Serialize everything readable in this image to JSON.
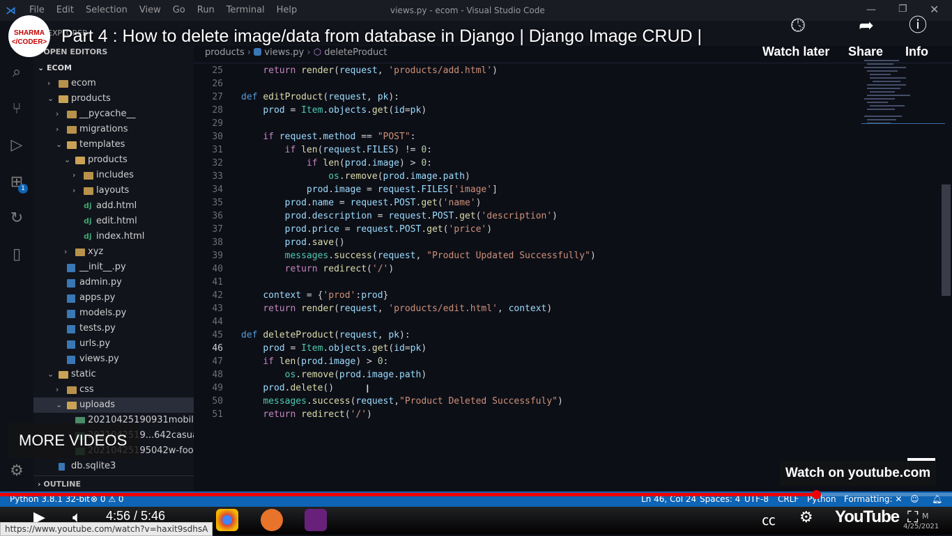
{
  "window": {
    "title": "views.py - ecom - Visual Studio Code",
    "menu": [
      "File",
      "Edit",
      "Selection",
      "View",
      "Go",
      "Run",
      "Terminal",
      "Help"
    ]
  },
  "youtube": {
    "title": "Part 4 : How to delete image/data from database in Django | Django Image CRUD |",
    "channel_line1": "SHARMA",
    "channel_line2": "</CODER>",
    "watch_later": "Watch later",
    "share": "Share",
    "info": "Info",
    "more_videos": "MORE VIDEOS",
    "watch_on": "Watch on youtube.com",
    "time": "4:56 / 5:46",
    "progress": 0.857,
    "url_tooltip": "https://www.youtube.com/watch?v=haxit9sdhsA",
    "logo_text": "YouTube"
  },
  "sidebar": {
    "explorer": "EXPLORER",
    "open_editors": "OPEN EDITORS",
    "root": "ECOM",
    "tree": [
      {
        "label": "ecom",
        "depth": 1,
        "kind": "folder",
        "open": false
      },
      {
        "label": "products",
        "depth": 1,
        "kind": "folder",
        "open": true
      },
      {
        "label": "__pycache__",
        "depth": 2,
        "kind": "folder",
        "open": false
      },
      {
        "label": "migrations",
        "depth": 2,
        "kind": "folder",
        "open": false
      },
      {
        "label": "templates",
        "depth": 2,
        "kind": "folder",
        "open": true
      },
      {
        "label": "products",
        "depth": 3,
        "kind": "folder",
        "open": true
      },
      {
        "label": "includes",
        "depth": 4,
        "kind": "folder",
        "open": false
      },
      {
        "label": "layouts",
        "depth": 4,
        "kind": "folder",
        "open": false
      },
      {
        "label": "add.html",
        "depth": 4,
        "kind": "dj"
      },
      {
        "label": "edit.html",
        "depth": 4,
        "kind": "dj"
      },
      {
        "label": "index.html",
        "depth": 4,
        "kind": "dj"
      },
      {
        "label": "xyz",
        "depth": 3,
        "kind": "folder",
        "open": false
      },
      {
        "label": "__init__.py",
        "depth": 2,
        "kind": "py"
      },
      {
        "label": "admin.py",
        "depth": 2,
        "kind": "py"
      },
      {
        "label": "apps.py",
        "depth": 2,
        "kind": "py"
      },
      {
        "label": "models.py",
        "depth": 2,
        "kind": "py"
      },
      {
        "label": "tests.py",
        "depth": 2,
        "kind": "py"
      },
      {
        "label": "urls.py",
        "depth": 2,
        "kind": "py"
      },
      {
        "label": "views.py",
        "depth": 2,
        "kind": "py"
      },
      {
        "label": "static",
        "depth": 1,
        "kind": "folder",
        "open": true
      },
      {
        "label": "css",
        "depth": 2,
        "kind": "folder",
        "open": false
      },
      {
        "label": "uploads",
        "depth": 2,
        "kind": "folder",
        "open": true,
        "selected": true
      },
      {
        "label": "20210425190931mobile-r...",
        "depth": 3,
        "kind": "img"
      },
      {
        "label": "2021042519...642casual_s...",
        "depth": 3,
        "kind": "img"
      },
      {
        "label": "20210425195042w-footw...",
        "depth": 3,
        "kind": "img"
      },
      {
        "label": "db.sqlite3",
        "depth": 1,
        "kind": "db"
      }
    ],
    "outline": "OUTLINE"
  },
  "breadcrumb": {
    "folder": "products",
    "file": "views.py",
    "symbol": "deleteProduct"
  },
  "code_lines": [
    {
      "n": "25",
      "tokens": [
        [
          "    ",
          ""
        ],
        [
          "return",
          "kw2"
        ],
        [
          " ",
          ""
        ],
        [
          "render",
          "fn"
        ],
        [
          "(",
          ""
        ],
        [
          "request",
          "var"
        ],
        [
          ", ",
          ""
        ],
        [
          "'products/add.html'",
          "str"
        ],
        [
          ")",
          ""
        ]
      ]
    },
    {
      "n": "26",
      "tokens": []
    },
    {
      "n": "27",
      "tokens": [
        [
          "def",
          "kw"
        ],
        [
          " ",
          ""
        ],
        [
          "editProduct",
          "fn"
        ],
        [
          "(",
          ""
        ],
        [
          "request",
          "var"
        ],
        [
          ", ",
          ""
        ],
        [
          "pk",
          "var"
        ],
        [
          "):",
          ""
        ]
      ]
    },
    {
      "n": "28",
      "tokens": [
        [
          "    ",
          ""
        ],
        [
          "prod",
          "var"
        ],
        [
          " = ",
          ""
        ],
        [
          "Item",
          "cls"
        ],
        [
          ".",
          ""
        ],
        [
          "objects",
          "var"
        ],
        [
          ".",
          ""
        ],
        [
          "get",
          "fn"
        ],
        [
          "(",
          ""
        ],
        [
          "id",
          "var"
        ],
        [
          "=",
          ""
        ],
        [
          "pk",
          "var"
        ],
        [
          ")",
          ""
        ]
      ]
    },
    {
      "n": "29",
      "tokens": []
    },
    {
      "n": "30",
      "tokens": [
        [
          "    ",
          ""
        ],
        [
          "if",
          "kw2"
        ],
        [
          " ",
          ""
        ],
        [
          "request",
          "var"
        ],
        [
          ".",
          ""
        ],
        [
          "method",
          "var"
        ],
        [
          " == ",
          ""
        ],
        [
          "\"POST\"",
          "str"
        ],
        [
          ":",
          ""
        ]
      ]
    },
    {
      "n": "31",
      "tokens": [
        [
          "        ",
          ""
        ],
        [
          "if",
          "kw2"
        ],
        [
          " ",
          ""
        ],
        [
          "len",
          "fn"
        ],
        [
          "(",
          ""
        ],
        [
          "request",
          "var"
        ],
        [
          ".",
          ""
        ],
        [
          "FILES",
          "var"
        ],
        [
          ") != ",
          ""
        ],
        [
          "0",
          "num-lit"
        ],
        [
          ":",
          ""
        ]
      ]
    },
    {
      "n": "32",
      "tokens": [
        [
          "            ",
          ""
        ],
        [
          "if",
          "kw2"
        ],
        [
          " ",
          ""
        ],
        [
          "len",
          "fn"
        ],
        [
          "(",
          ""
        ],
        [
          "prod",
          "var"
        ],
        [
          ".",
          ""
        ],
        [
          "image",
          "var"
        ],
        [
          ") > ",
          ""
        ],
        [
          "0",
          "num-lit"
        ],
        [
          ":",
          ""
        ]
      ]
    },
    {
      "n": "33",
      "tokens": [
        [
          "                ",
          ""
        ],
        [
          "os",
          "cls"
        ],
        [
          ".",
          ""
        ],
        [
          "remove",
          "fn"
        ],
        [
          "(",
          ""
        ],
        [
          "prod",
          "var"
        ],
        [
          ".",
          ""
        ],
        [
          "image",
          "var"
        ],
        [
          ".",
          ""
        ],
        [
          "path",
          "var"
        ],
        [
          ")",
          ""
        ]
      ]
    },
    {
      "n": "34",
      "tokens": [
        [
          "            ",
          ""
        ],
        [
          "prod",
          "var"
        ],
        [
          ".",
          ""
        ],
        [
          "image",
          "var"
        ],
        [
          " = ",
          ""
        ],
        [
          "request",
          "var"
        ],
        [
          ".",
          ""
        ],
        [
          "FILES",
          "var"
        ],
        [
          "[",
          ""
        ],
        [
          "'image'",
          "str"
        ],
        [
          "]",
          ""
        ]
      ]
    },
    {
      "n": "35",
      "tokens": [
        [
          "        ",
          ""
        ],
        [
          "prod",
          "var"
        ],
        [
          ".",
          ""
        ],
        [
          "name",
          "var"
        ],
        [
          " = ",
          ""
        ],
        [
          "request",
          "var"
        ],
        [
          ".",
          ""
        ],
        [
          "POST",
          "var"
        ],
        [
          ".",
          ""
        ],
        [
          "get",
          "fn"
        ],
        [
          "(",
          ""
        ],
        [
          "'name'",
          "str"
        ],
        [
          ")",
          ""
        ]
      ]
    },
    {
      "n": "36",
      "tokens": [
        [
          "        ",
          ""
        ],
        [
          "prod",
          "var"
        ],
        [
          ".",
          ""
        ],
        [
          "description",
          "var"
        ],
        [
          " = ",
          ""
        ],
        [
          "request",
          "var"
        ],
        [
          ".",
          ""
        ],
        [
          "POST",
          "var"
        ],
        [
          ".",
          ""
        ],
        [
          "get",
          "fn"
        ],
        [
          "(",
          ""
        ],
        [
          "'description'",
          "str"
        ],
        [
          ")",
          ""
        ]
      ]
    },
    {
      "n": "37",
      "tokens": [
        [
          "        ",
          ""
        ],
        [
          "prod",
          "var"
        ],
        [
          ".",
          ""
        ],
        [
          "price",
          "var"
        ],
        [
          " = ",
          ""
        ],
        [
          "request",
          "var"
        ],
        [
          ".",
          ""
        ],
        [
          "POST",
          "var"
        ],
        [
          ".",
          ""
        ],
        [
          "get",
          "fn"
        ],
        [
          "(",
          ""
        ],
        [
          "'price'",
          "str"
        ],
        [
          ")",
          ""
        ]
      ]
    },
    {
      "n": "38",
      "tokens": [
        [
          "        ",
          ""
        ],
        [
          "prod",
          "var"
        ],
        [
          ".",
          ""
        ],
        [
          "save",
          "fn"
        ],
        [
          "()",
          ""
        ]
      ]
    },
    {
      "n": "39",
      "tokens": [
        [
          "        ",
          ""
        ],
        [
          "messages",
          "cls"
        ],
        [
          ".",
          ""
        ],
        [
          "success",
          "fn"
        ],
        [
          "(",
          ""
        ],
        [
          "request",
          "var"
        ],
        [
          ", ",
          ""
        ],
        [
          "\"Product Updated Successfully\"",
          "str"
        ],
        [
          ")",
          ""
        ]
      ]
    },
    {
      "n": "40",
      "tokens": [
        [
          "        ",
          ""
        ],
        [
          "return",
          "kw2"
        ],
        [
          " ",
          ""
        ],
        [
          "redirect",
          "fn"
        ],
        [
          "(",
          ""
        ],
        [
          "'/'",
          "str"
        ],
        [
          ")",
          ""
        ]
      ]
    },
    {
      "n": "41",
      "tokens": []
    },
    {
      "n": "42",
      "tokens": [
        [
          "    ",
          ""
        ],
        [
          "context",
          "var"
        ],
        [
          " = {",
          ""
        ],
        [
          "'prod'",
          "str"
        ],
        [
          ":",
          ""
        ],
        [
          "prod",
          "var"
        ],
        [
          "}",
          ""
        ]
      ]
    },
    {
      "n": "43",
      "tokens": [
        [
          "    ",
          ""
        ],
        [
          "return",
          "kw2"
        ],
        [
          " ",
          ""
        ],
        [
          "render",
          "fn"
        ],
        [
          "(",
          ""
        ],
        [
          "request",
          "var"
        ],
        [
          ", ",
          ""
        ],
        [
          "'products/edit.html'",
          "str"
        ],
        [
          ", ",
          ""
        ],
        [
          "context",
          "var"
        ],
        [
          ")",
          ""
        ]
      ]
    },
    {
      "n": "44",
      "tokens": []
    },
    {
      "n": "45",
      "tokens": [
        [
          "def",
          "kw"
        ],
        [
          " ",
          ""
        ],
        [
          "deleteProduct",
          "fn"
        ],
        [
          "(",
          ""
        ],
        [
          "request",
          "var"
        ],
        [
          ", ",
          ""
        ],
        [
          "pk",
          "var"
        ],
        [
          "):",
          ""
        ]
      ]
    },
    {
      "n": "46",
      "active": true,
      "tokens": [
        [
          "    ",
          ""
        ],
        [
          "prod",
          "var"
        ],
        [
          " = ",
          ""
        ],
        [
          "Item",
          "cls"
        ],
        [
          ".",
          ""
        ],
        [
          "objects",
          "var"
        ],
        [
          ".",
          ""
        ],
        [
          "get",
          "fn"
        ],
        [
          "(",
          ""
        ],
        [
          "id",
          "var"
        ],
        [
          "=",
          ""
        ],
        [
          "pk",
          "var"
        ],
        [
          ")",
          ""
        ]
      ]
    },
    {
      "n": "47",
      "tokens": [
        [
          "    ",
          ""
        ],
        [
          "if",
          "kw2"
        ],
        [
          " ",
          ""
        ],
        [
          "len",
          "fn"
        ],
        [
          "(",
          ""
        ],
        [
          "prod",
          "var"
        ],
        [
          ".",
          ""
        ],
        [
          "image",
          "var"
        ],
        [
          ") > ",
          ""
        ],
        [
          "0",
          "num-lit"
        ],
        [
          ":",
          ""
        ]
      ]
    },
    {
      "n": "48",
      "tokens": [
        [
          "        ",
          ""
        ],
        [
          "os",
          "cls"
        ],
        [
          ".",
          ""
        ],
        [
          "remove",
          "fn"
        ],
        [
          "(",
          ""
        ],
        [
          "prod",
          "var"
        ],
        [
          ".",
          ""
        ],
        [
          "image",
          "var"
        ],
        [
          ".",
          ""
        ],
        [
          "path",
          "var"
        ],
        [
          ")",
          ""
        ]
      ]
    },
    {
      "n": "49",
      "tokens": [
        [
          "    ",
          ""
        ],
        [
          "prod",
          "var"
        ],
        [
          ".",
          ""
        ],
        [
          "delete",
          "fn"
        ],
        [
          "()",
          ""
        ]
      ]
    },
    {
      "n": "50",
      "tokens": [
        [
          "    ",
          ""
        ],
        [
          "messages",
          "cls"
        ],
        [
          ".",
          ""
        ],
        [
          "success",
          "fn"
        ],
        [
          "(",
          ""
        ],
        [
          "request",
          "var"
        ],
        [
          ",",
          ""
        ],
        [
          "\"Product Deleted Successfuly\"",
          "str"
        ],
        [
          ")",
          ""
        ]
      ]
    },
    {
      "n": "51",
      "tokens": [
        [
          "    ",
          ""
        ],
        [
          "return",
          "kw2"
        ],
        [
          " ",
          ""
        ],
        [
          "redirect",
          "fn"
        ],
        [
          "(",
          ""
        ],
        [
          "'/'",
          "str"
        ],
        [
          ")",
          ""
        ]
      ]
    }
  ],
  "statusbar": {
    "python": "Python 3.8.1 32-bit",
    "problems": "⊗ 0 ⚠ 0",
    "position": "Ln 46, Col 24",
    "spaces": "Spaces: 4",
    "encoding": "UTF-8",
    "eol": "CRLF",
    "language": "Python",
    "formatting": "Formatting: ✕"
  },
  "taskbar": {
    "clock_date": "4/25/2021",
    "clock_time": "M"
  },
  "colors": {
    "status_blue": "#0e64b5",
    "progress_red": "#e00000",
    "editor_bg": "#0d0f17"
  },
  "icons": {
    "activity": [
      "files-icon",
      "search-icon",
      "source-control-icon",
      "run-debug-icon",
      "extensions-icon",
      "remote-icon",
      "database-icon",
      "gear-icon"
    ]
  }
}
